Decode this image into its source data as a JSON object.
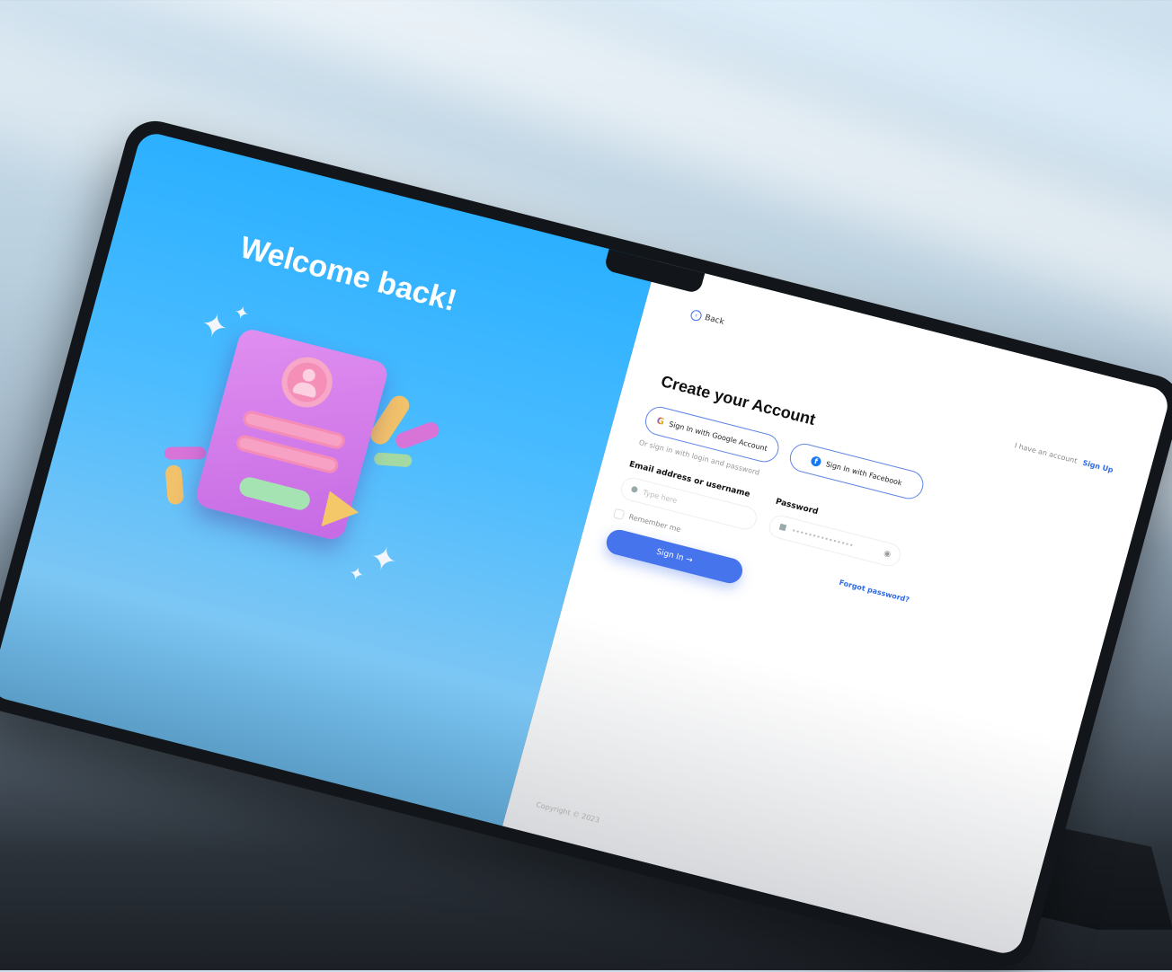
{
  "left_panel": {
    "heading": "Welcome back!"
  },
  "nav": {
    "back_label": "Back",
    "have_account_text": "I have an account",
    "sign_up_link": "Sign Up"
  },
  "form": {
    "title": "Create your Account",
    "google_button": "Sign In with Google Account",
    "facebook_button": "Sign In with Facebook",
    "divider_text": "Or sign in with login and password",
    "email_label": "Email address or username",
    "email_placeholder": "Type here",
    "password_label": "Password",
    "password_value": "•••••••••••••••",
    "remember_label": "Remember me",
    "sign_in_button": "Sign In →",
    "forgot_link": "Forgot password?"
  },
  "footer": {
    "copyright": "Copyright © 2023"
  },
  "colors": {
    "accent": "#4674ec",
    "left_panel": "#2bb0ff",
    "link": "#2f6bea"
  },
  "icons": [
    "back-circle-icon",
    "google-icon",
    "facebook-icon",
    "user-icon",
    "lock-icon",
    "eye-icon",
    "arrow-right-icon"
  ]
}
